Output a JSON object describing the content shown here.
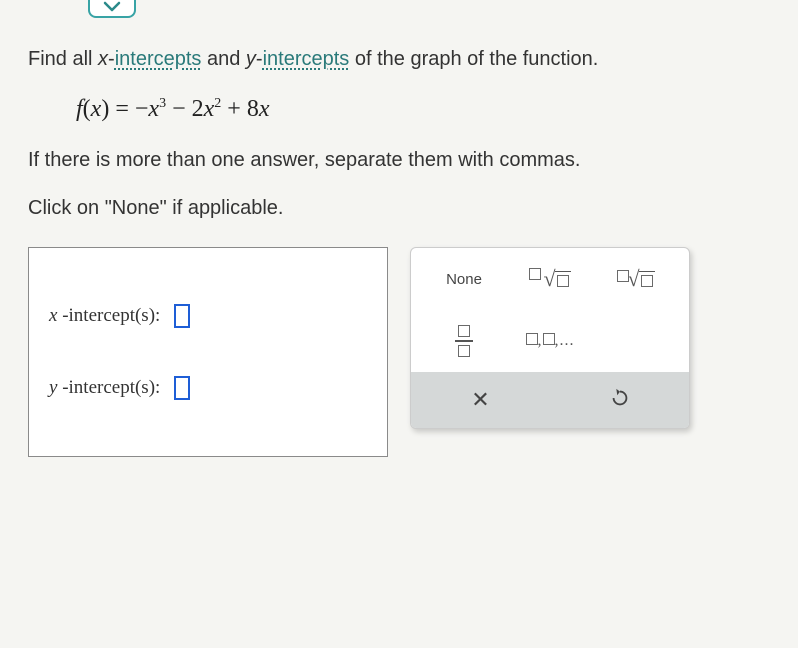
{
  "question": {
    "prefix": "Find all ",
    "x_var": "x",
    "dash1": "-",
    "intercepts_word1": "intercepts",
    "mid": " and ",
    "y_var": "y",
    "dash2": "-",
    "intercepts_word2": "intercepts",
    "suffix": " of the graph of the function."
  },
  "equation": "f(x) = −x³ − 2x² + 8x",
  "instruction2": "If there is more than one answer, separate them with commas.",
  "instruction3": "Click on \"None\" if applicable.",
  "answers": {
    "x_label_var": "x",
    "x_label_rest": "-intercept(s):",
    "y_label_var": "y",
    "y_label_rest": "-intercept(s):"
  },
  "keypad": {
    "none": "None",
    "list": "□,□,..."
  }
}
